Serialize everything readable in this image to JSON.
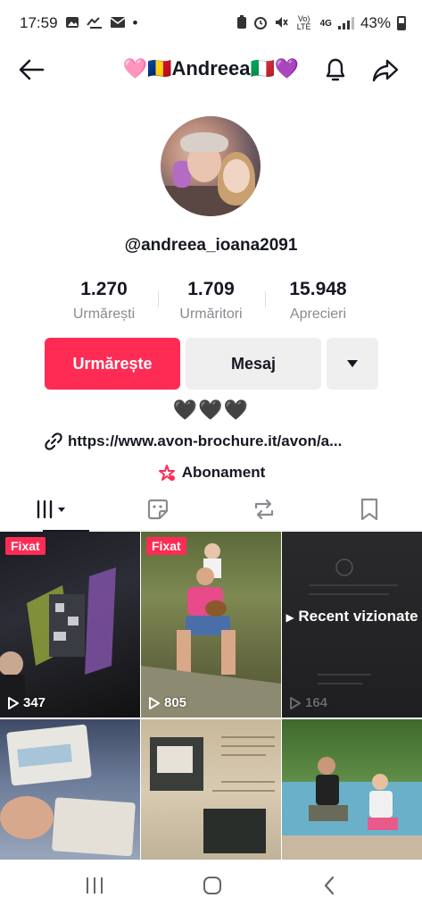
{
  "status_bar": {
    "time": "17:59",
    "dot": "•",
    "network_volte": "Vo) LTE",
    "network_type": "4G",
    "battery": "43%"
  },
  "header": {
    "title": "🩷🇷🇴Andreea🇮🇹💜"
  },
  "profile": {
    "username": "@andreea_ioana2091",
    "stats": [
      {
        "value": "1.270",
        "label": "Urmărești"
      },
      {
        "value": "1.709",
        "label": "Urmăritori"
      },
      {
        "value": "15.948",
        "label": "Aprecieri"
      }
    ],
    "follow_label": "Urmărește",
    "message_label": "Mesaj",
    "bio": "🖤🖤🖤",
    "link": "https://www.avon-brochure.it/avon/a...",
    "subscription_label": "Abonament"
  },
  "videos": [
    {
      "pinned": "Fixat",
      "views": "347"
    },
    {
      "pinned": "Fixat",
      "views": "805"
    },
    {
      "overlay": "Recent vizionate",
      "views": "164"
    },
    {},
    {},
    {}
  ],
  "colors": {
    "accent": "#fe2c55",
    "secondary_button": "#efeff0",
    "muted_text": "#8a8b91"
  }
}
